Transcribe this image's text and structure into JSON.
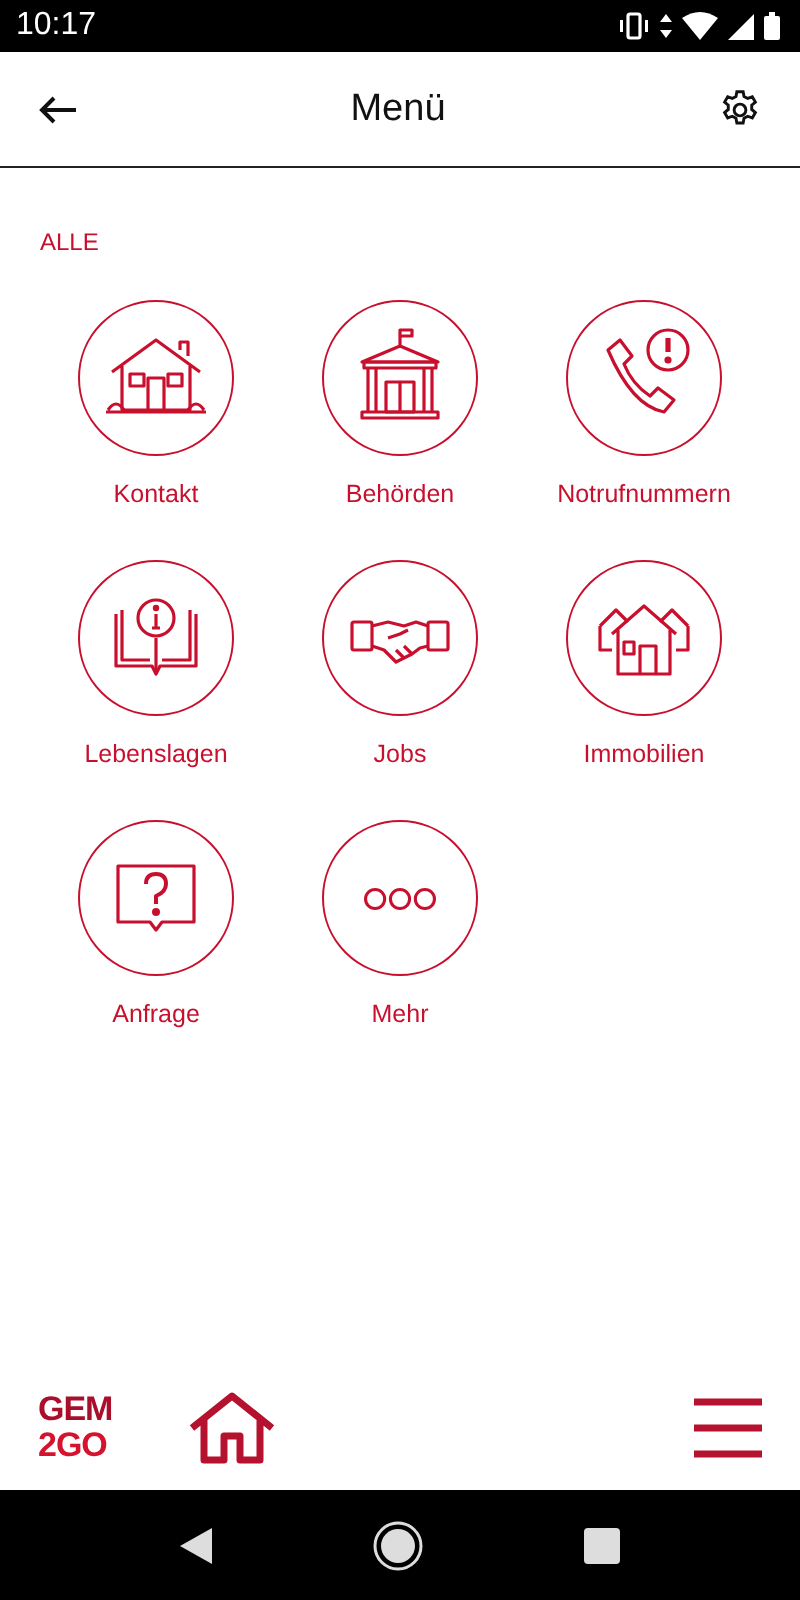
{
  "status_bar": {
    "time": "10:17"
  },
  "header": {
    "title": "Menü"
  },
  "section": {
    "label": "ALLE"
  },
  "tiles": [
    {
      "kind": "house",
      "label": "Kontakt"
    },
    {
      "kind": "building",
      "label": "Behörden"
    },
    {
      "kind": "phone",
      "label": "Notrufnummern"
    },
    {
      "kind": "book",
      "label": "Lebenslagen"
    },
    {
      "kind": "handshake",
      "label": "Jobs"
    },
    {
      "kind": "houses",
      "label": "Immobilien"
    },
    {
      "kind": "question",
      "label": "Anfrage"
    },
    {
      "kind": "more",
      "label": "Mehr"
    }
  ],
  "bottom_bar": {
    "logo_lines": [
      "GEM",
      "2GO"
    ]
  }
}
